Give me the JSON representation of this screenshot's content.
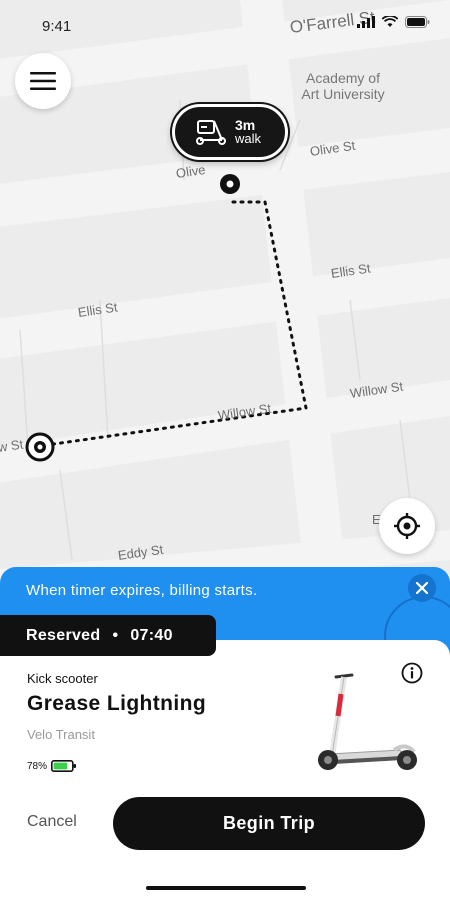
{
  "status_bar": {
    "time": "9:41"
  },
  "map": {
    "streets": {
      "ofarrell": "O'Farrell St",
      "olive_top": "Olive St",
      "olive_left": "Olive",
      "ellis_right": "Ellis St",
      "ellis_left": "Ellis St",
      "willow_right": "Willow St",
      "willow_mid": "Willow St",
      "willow_left": "w St",
      "eddy": "Eddy St",
      "edge": "E"
    },
    "place": {
      "line1": "Academy of",
      "line2": "Art University"
    },
    "walk": {
      "minutes": "3m",
      "label": "walk"
    }
  },
  "banner": {
    "text": "When timer expires, billing starts."
  },
  "reservation": {
    "label": "Reserved",
    "separator": "•",
    "timer": "07:40"
  },
  "vehicle": {
    "type": "Kick scooter",
    "name": "Grease Lightning",
    "operator": "Velo Transit",
    "battery": "78%",
    "battery_level": 0.78,
    "battery_color": "#3ccf4e"
  },
  "actions": {
    "cancel": "Cancel",
    "begin": "Begin Trip"
  },
  "icons": {
    "menu": "hamburger-icon",
    "scooter": "scooter-icon",
    "locate": "crosshair-icon",
    "close": "close-icon",
    "info": "info-icon"
  },
  "colors": {
    "banner": "#1f8ff0",
    "primary": "#111111"
  }
}
